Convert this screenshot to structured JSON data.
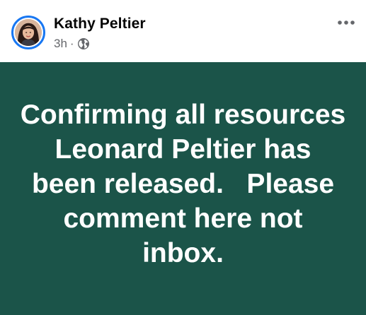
{
  "post": {
    "author": "Kathy Peltier",
    "timestamp": "3h",
    "separator": "·",
    "privacy_icon": "globe-icon",
    "more_icon": "more-horizontal-icon",
    "text": "Confirming all resources Leonard Peltier has been released.   Please comment here not inbox.",
    "background_color": "#1b5449",
    "text_color": "#ffffff",
    "avatar_ring_color": "#1877f2"
  }
}
